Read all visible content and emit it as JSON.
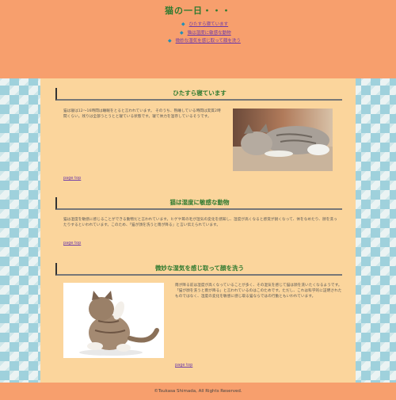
{
  "site": {
    "title": "猫の一日・・・"
  },
  "nav": {
    "items": [
      {
        "label": "ひたすら寝ています"
      },
      {
        "label": "猫は湿度に敏感な動物"
      },
      {
        "label": "微妙な湿気を感じ取って顔を洗う"
      }
    ]
  },
  "sections": [
    {
      "heading": "ひたすら寝ています",
      "body": "猫は寝は12～16時間は睡眠をとると言われています。 そのうち、熟睡している時間は実質2時間くらい。残りは全部うとうとと寝ている状態です。寝て体力を温存しているそうです。",
      "top_link": "page top"
    },
    {
      "heading": "猫は湿度に敏感な動物",
      "body": "猫は湿度を敏感に感じることができる動物だと言われています。ヒゲや耳の毛が湿気の変化を感知し、湿度が高くなると感覚が鋭くなって、体をなめたり、顔を洗ったりするといわれています。このため、「猫が顔を洗うと雨が降る」と言い伝えられています。",
      "top_link": "page top"
    },
    {
      "heading": "微妙な湿気を感じ取って顔を洗う",
      "body": "雨が降る前は湿度が高くなっていることが多く、その湿気を感じて猫は顔を洗いたくなるようです。「猫が顔を洗うと雨が降る」と言われているのはこのためです。ただし、これは科学的に証明されたものではなく、湿度の変化を敏感に感じ取る猫ならではの行動ともいわれています。",
      "top_link": "page top"
    }
  ],
  "footer": {
    "copyright": "©Tsukasa Shimada, All Rights Reserved."
  }
}
